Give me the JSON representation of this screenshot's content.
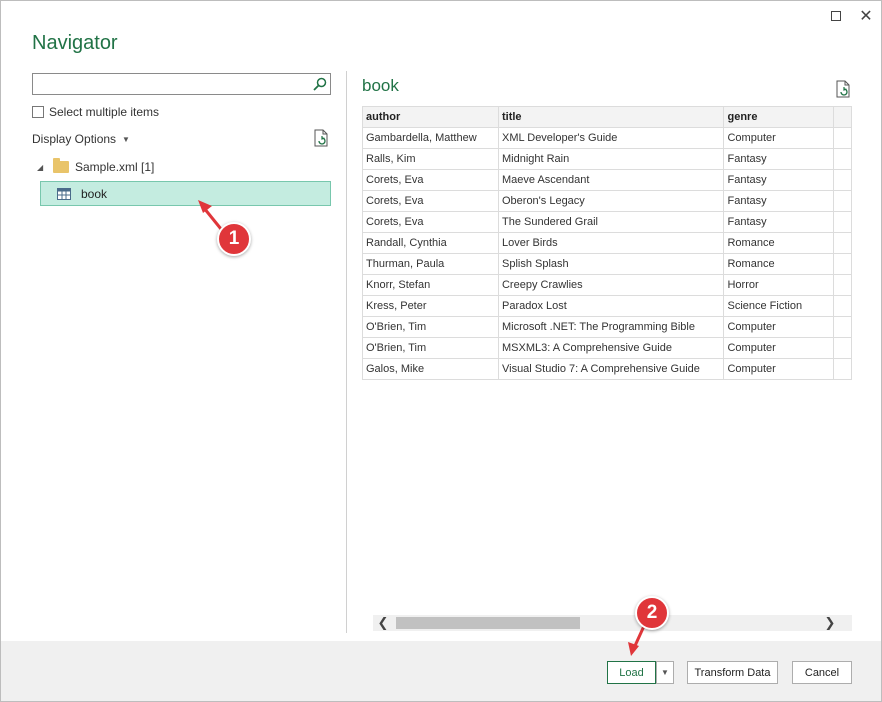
{
  "window": {
    "title": "Navigator"
  },
  "left_pane": {
    "search": {
      "value": "",
      "placeholder": ""
    },
    "select_multiple_label": "Select multiple items",
    "display_options_label": "Display Options",
    "tree": {
      "parent_label": "Sample.xml [1]",
      "child_label": "book"
    }
  },
  "preview": {
    "title": "book",
    "columns": [
      "author",
      "title",
      "genre"
    ],
    "rows": [
      [
        "Gambardella, Matthew",
        "XML Developer's Guide",
        "Computer"
      ],
      [
        "Ralls, Kim",
        "Midnight Rain",
        "Fantasy"
      ],
      [
        "Corets, Eva",
        "Maeve Ascendant",
        "Fantasy"
      ],
      [
        "Corets, Eva",
        "Oberon's Legacy",
        "Fantasy"
      ],
      [
        "Corets, Eva",
        "The Sundered Grail",
        "Fantasy"
      ],
      [
        "Randall, Cynthia",
        "Lover Birds",
        "Romance"
      ],
      [
        "Thurman, Paula",
        "Splish Splash",
        "Romance"
      ],
      [
        "Knorr, Stefan",
        "Creepy Crawlies",
        "Horror"
      ],
      [
        "Kress, Peter",
        "Paradox Lost",
        "Science Fiction"
      ],
      [
        "O'Brien, Tim",
        "Microsoft .NET: The Programming Bible",
        "Computer"
      ],
      [
        "O'Brien, Tim",
        "MSXML3: A Comprehensive Guide",
        "Computer"
      ],
      [
        "Galos, Mike",
        "Visual Studio 7: A Comprehensive Guide",
        "Computer"
      ]
    ]
  },
  "footer": {
    "load_label": "Load",
    "transform_label": "Transform Data",
    "cancel_label": "Cancel"
  },
  "annotations": {
    "badge1": "1",
    "badge2": "2"
  },
  "colors": {
    "accent": "#217346",
    "selection": "#c4ece0",
    "badge": "#e0363a"
  }
}
